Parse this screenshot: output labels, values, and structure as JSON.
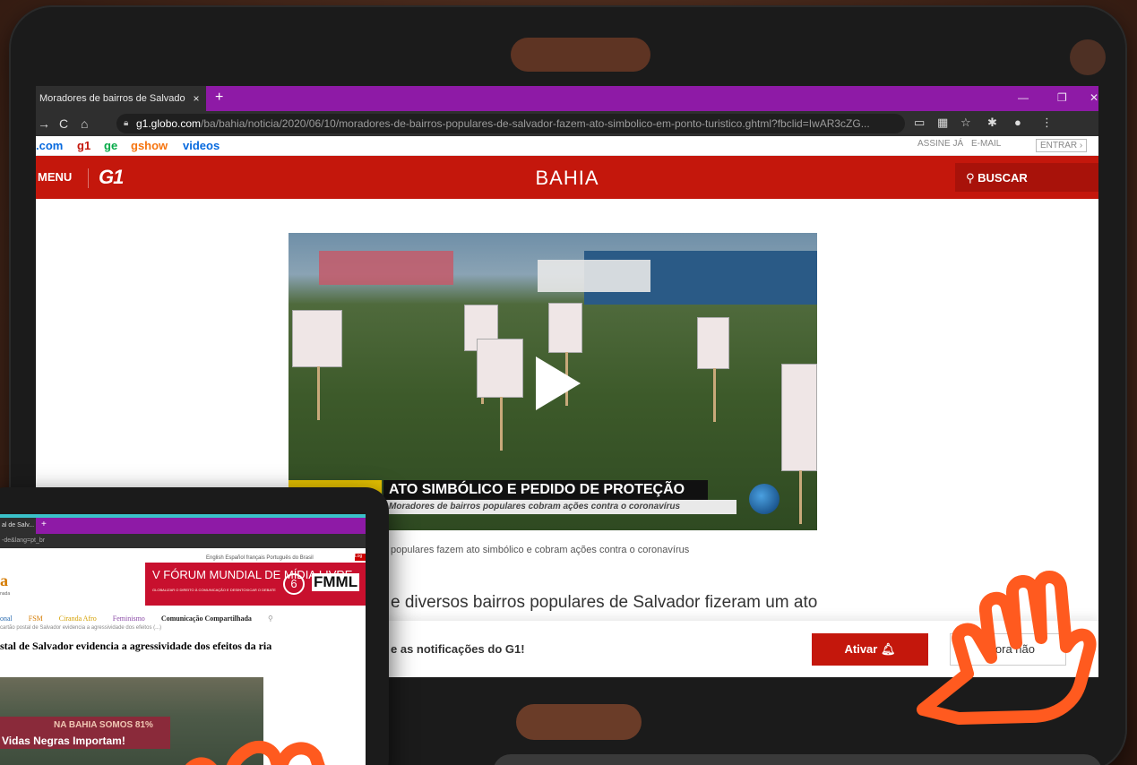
{
  "main_browser": {
    "tab_title": "Moradores de bairros de Salvado",
    "tab_close": "×",
    "new_tab": "+",
    "url_domain": "g1.globo.com",
    "url_path": "/ba/bahia/noticia/2020/06/10/moradores-de-bairros-populares-de-salvador-fazem-ato-simbolico-em-ponto-turistico.ghtml?fbclid=IwAR3cZG...",
    "globo_links": [
      ".com",
      "g1",
      "ge",
      "gshow",
      "videos"
    ],
    "globo_right": {
      "assine": "ASSINE JÁ",
      "email": "E-MAIL",
      "entrar": "ENTRAR ›"
    },
    "header": {
      "menu": "MENU",
      "logo": "G1",
      "section": "BAHIA",
      "search": "BUSCAR"
    },
    "video": {
      "caption_main": "ATO SIMBÓLICO E PEDIDO DE PROTEÇÃO",
      "caption_sub": "Moradores de bairros populares cobram ações contra o coronavírus"
    },
    "photo_caption": "populares fazem ato simbólico e cobram ações contra o coronavírus",
    "lead_text": "e diversos bairros populares de Salvador fizeram um ato",
    "notification": {
      "text": "e as notificações do G1!",
      "activate_label": "Ativar",
      "dismiss_label": "Agora não"
    }
  },
  "second_browser": {
    "tab_title": "al de Salv... ×",
    "address": "-de&lang=pt_br",
    "languages": "English Español français Português do Brasil",
    "login": "Log",
    "logo": "a",
    "logo_sub": "nada",
    "ad_title": "V FÓRUM MUNDIAL DE MÍDIA LIVRE",
    "ad_sub": "GLOBALIZAR O DIREITO À COMUNICAÇÃO E DESINTOXICAR O DEBATE",
    "ad_number": "6",
    "ad_brand": "FMML",
    "nav": [
      "onal",
      "FSM",
      "Ciranda Afro",
      "Feminismo",
      "Comunicação Compartilhada"
    ],
    "breadcrumb": "cartão postal de Salvador evidencia a agressividade dos efeitos (...)",
    "headline": "stal de Salvador evidencia a agressividade dos efeitos da ria",
    "photo_banner": "NA BAHIA SOMOS 81%",
    "photo_banner2": "Vidas Negras Importam!"
  },
  "colors": {
    "g1_red": "#c4170c",
    "tab_purple": "#8e1aa6",
    "hand_orange": "#ff5a1f"
  }
}
